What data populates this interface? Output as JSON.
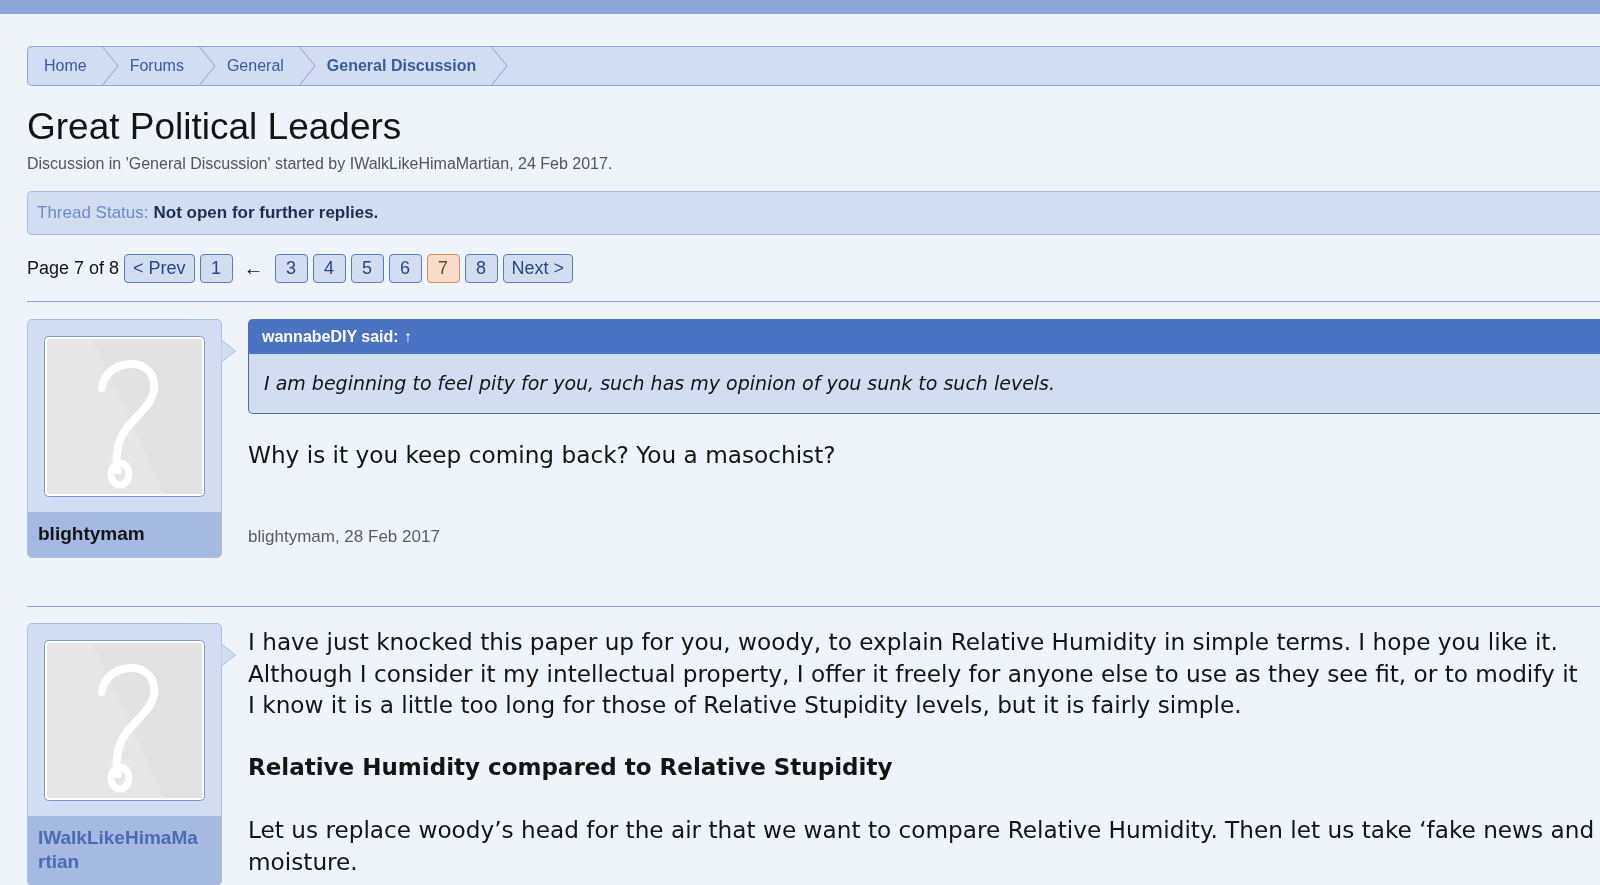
{
  "breadcrumbs": [
    {
      "label": "Home",
      "current": false
    },
    {
      "label": "Forums",
      "current": false
    },
    {
      "label": "General",
      "current": false
    },
    {
      "label": "General Discussion",
      "current": true
    }
  ],
  "thread": {
    "title": "Great Political Leaders",
    "meta": "Discussion in 'General Discussion' started by IWalkLikeHimaMartian, 24 Feb 2017.",
    "status_label": "Thread Status:",
    "status_value": "Not open for further replies."
  },
  "pagination": {
    "label": "Page 7 of 8",
    "items": [
      {
        "kind": "prev",
        "label": "< Prev"
      },
      {
        "kind": "page",
        "label": "1",
        "selected": false
      },
      {
        "kind": "skip",
        "label": "←"
      },
      {
        "kind": "page",
        "label": "3",
        "selected": false
      },
      {
        "kind": "page",
        "label": "4",
        "selected": false
      },
      {
        "kind": "page",
        "label": "5",
        "selected": false
      },
      {
        "kind": "page",
        "label": "6",
        "selected": false
      },
      {
        "kind": "page",
        "label": "7",
        "selected": true
      },
      {
        "kind": "page",
        "label": "8",
        "selected": false
      },
      {
        "kind": "next",
        "label": "Next >"
      }
    ]
  },
  "posts": [
    {
      "author": {
        "name": "blightymam",
        "color": "#141414"
      },
      "quote": {
        "author": "wannabeDIY said:",
        "link": "↑",
        "text": "I am beginning to feel pity for you, such has my opinion of you sunk to such levels."
      },
      "body": [
        {
          "kind": "paragraph",
          "lines": [
            "Why is it you keep coming back? You a masochist?"
          ]
        }
      ],
      "footer": "blightymam, 28 Feb 2017"
    },
    {
      "author": {
        "name": "IWalkLikeHimaMartian",
        "color": "#4a6cb3"
      },
      "body": [
        {
          "kind": "paragraph",
          "lines": [
            "I have just knocked this paper up for you, woody, to explain Relative Humidity in simple terms. I hope you like it.",
            "Although I consider it my intellectual property, I offer it freely for anyone else to use as they see fit, or to modify it",
            "I know it is a little too long for those of Relative Stupidity levels, but it is fairly simple."
          ]
        },
        {
          "kind": "heading",
          "lines": [
            "Relative Humidity compared to Relative Stupidity"
          ]
        },
        {
          "kind": "paragraph",
          "lines": [
            "Let us replace woody’s head for the air that we want to compare Relative Humidity. Then let us take ‘fake news and",
            "moisture."
          ]
        }
      ]
    }
  ]
}
